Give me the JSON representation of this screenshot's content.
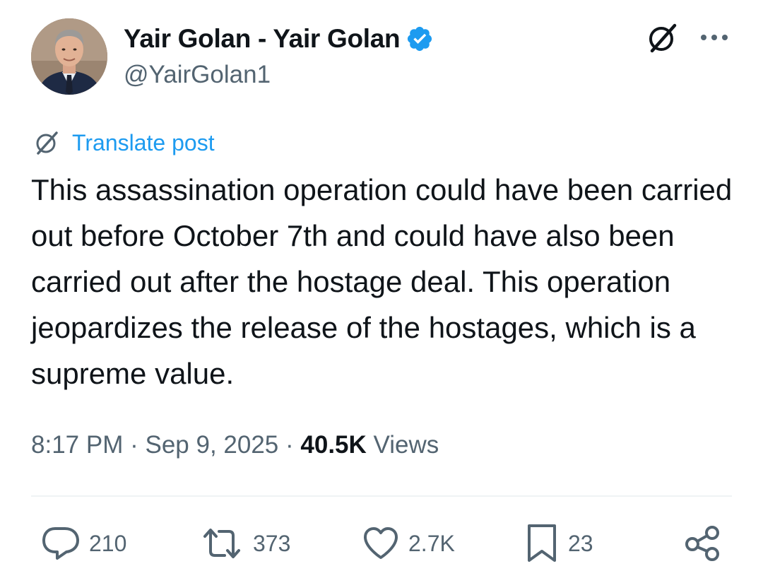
{
  "author": {
    "display_name": "Yair Golan - Yair Golan",
    "handle": "@YairGolan1",
    "verified": true,
    "verified_color": "#1d9bf0"
  },
  "header_actions": {
    "grok_icon": "grok-icon",
    "more_icon": "more-horizontal-icon"
  },
  "translate": {
    "label": "Translate post",
    "icon": "grok-icon",
    "color": "#1d9bf0"
  },
  "post": {
    "text": "This assassination operation could have been carried out before October 7th and could have also been carried out after the hostage deal. This operation jeopardizes the release of the hostages, which is a supreme value."
  },
  "meta": {
    "time": "8:17 PM",
    "separator": "·",
    "date": "Sep 9, 2025",
    "views_count": "40.5K",
    "views_label": "Views"
  },
  "actions": {
    "replies": "210",
    "reposts": "373",
    "likes": "2.7K",
    "bookmarks": "23"
  },
  "colors": {
    "text_primary": "#0f1419",
    "text_secondary": "#536471",
    "accent": "#1d9bf0",
    "divider": "#eff3f4"
  }
}
